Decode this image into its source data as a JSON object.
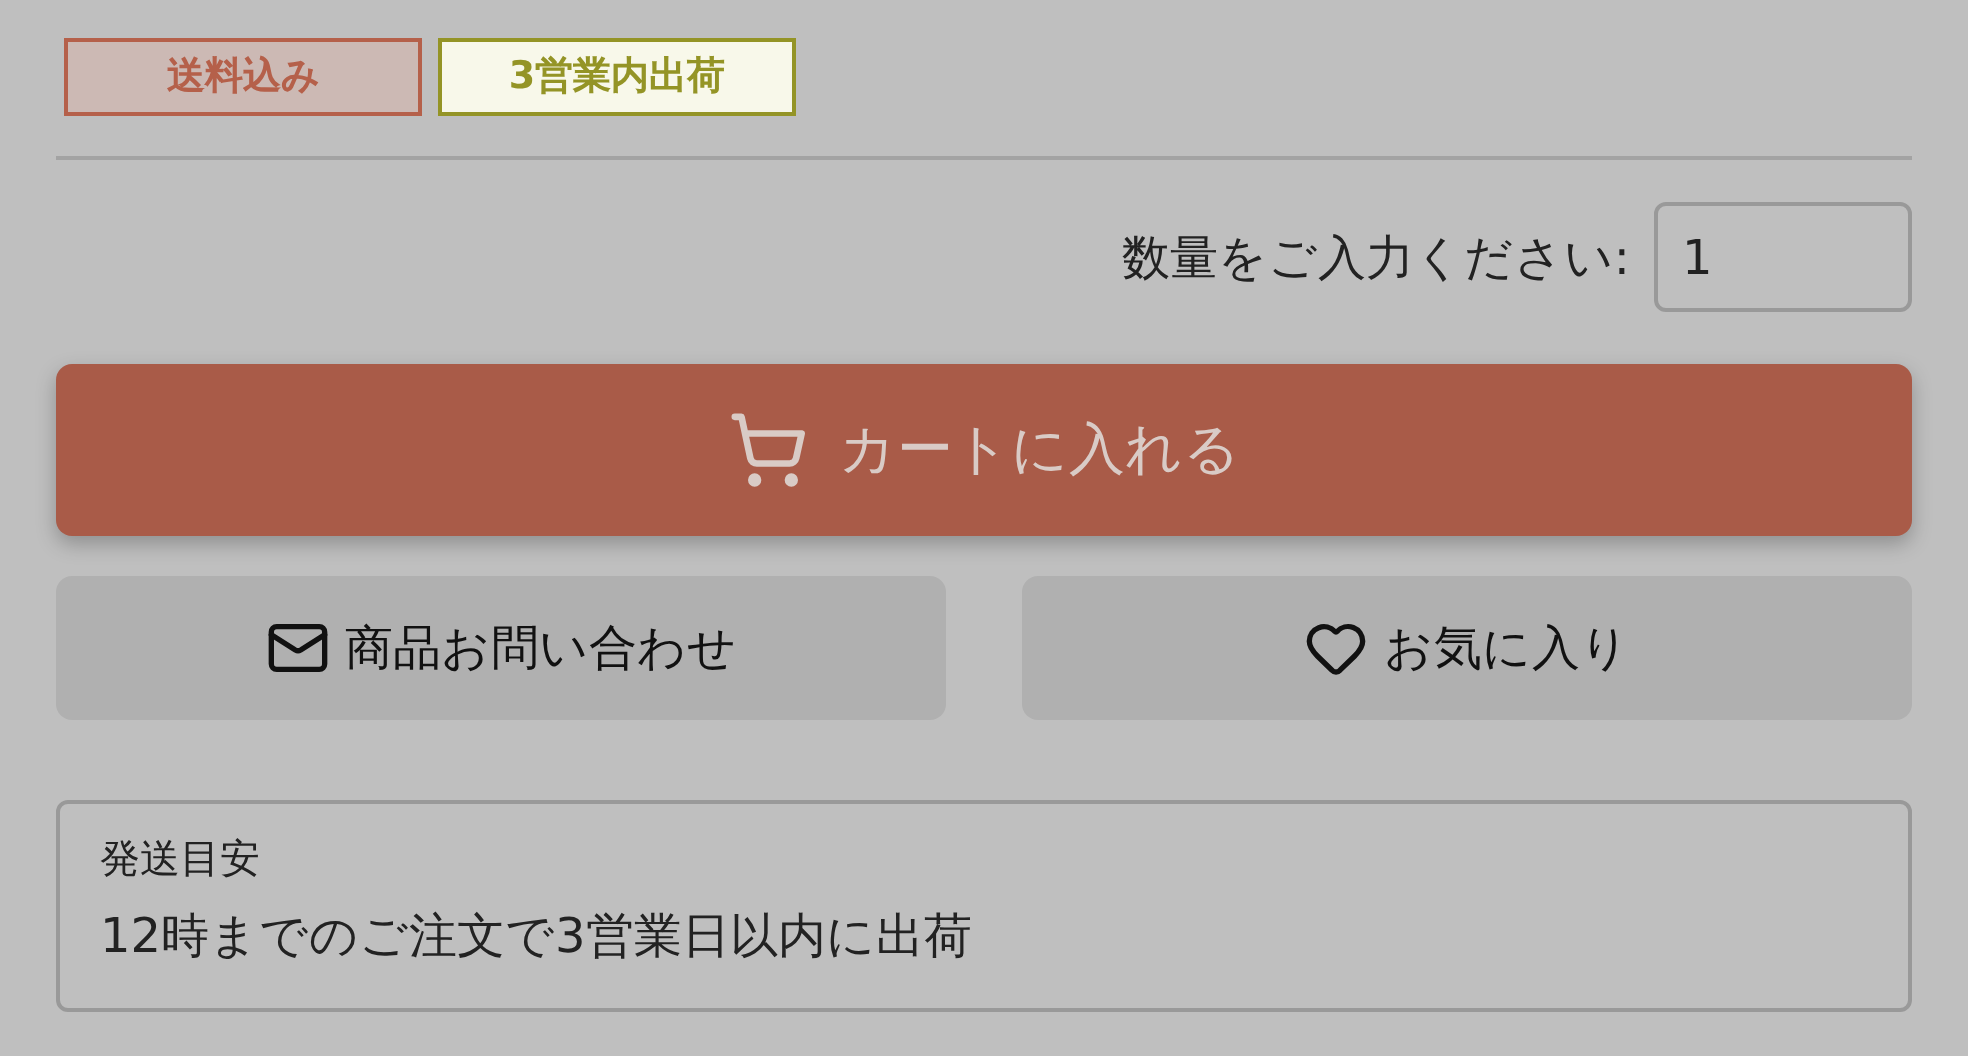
{
  "tags": [
    {
      "label": "送料込み",
      "color": "#b5604a"
    },
    {
      "label": "3営業内出荷",
      "color": "#949426"
    }
  ],
  "quantity": {
    "label": "数量をご入力ください:",
    "value": "1"
  },
  "cart_button": {
    "label": "カートに入れる"
  },
  "actions": [
    {
      "kind": "inquiry",
      "label": "商品お問い合わせ"
    },
    {
      "kind": "favorite",
      "label": "お気に入り"
    }
  ],
  "shipping": {
    "title": "発送目安",
    "text": "12時までのご注文で3営業日以内に出荷"
  }
}
